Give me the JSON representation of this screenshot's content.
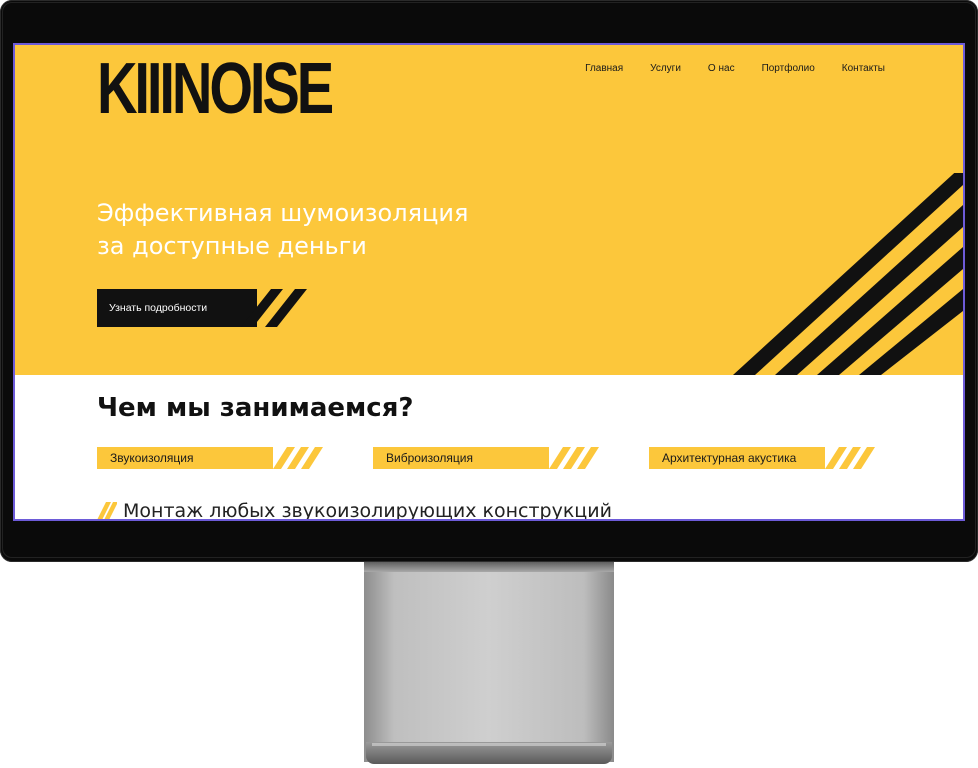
{
  "brand": {
    "logo": "KIIINOISE",
    "accent": "#fcc73b",
    "dark": "#111111"
  },
  "nav": {
    "items": [
      {
        "label": "Главная"
      },
      {
        "label": "Услуги"
      },
      {
        "label": "О нас"
      },
      {
        "label": "Портфолио"
      },
      {
        "label": "Контакты"
      }
    ]
  },
  "hero": {
    "headline_line1": "Эффективная шумоизоляция",
    "headline_line2": "за доступные деньги",
    "cta_label": "Узнать подробности"
  },
  "services_section": {
    "title": "Чем мы занимаемся?",
    "items": [
      {
        "label": "Звукоизоляция"
      },
      {
        "label": "Виброизоляция"
      },
      {
        "label": "Архитектурная акустика"
      }
    ]
  },
  "feature": {
    "text": "Монтаж любых звукоизолирующих конструкций",
    "icon": "stripes-icon"
  }
}
